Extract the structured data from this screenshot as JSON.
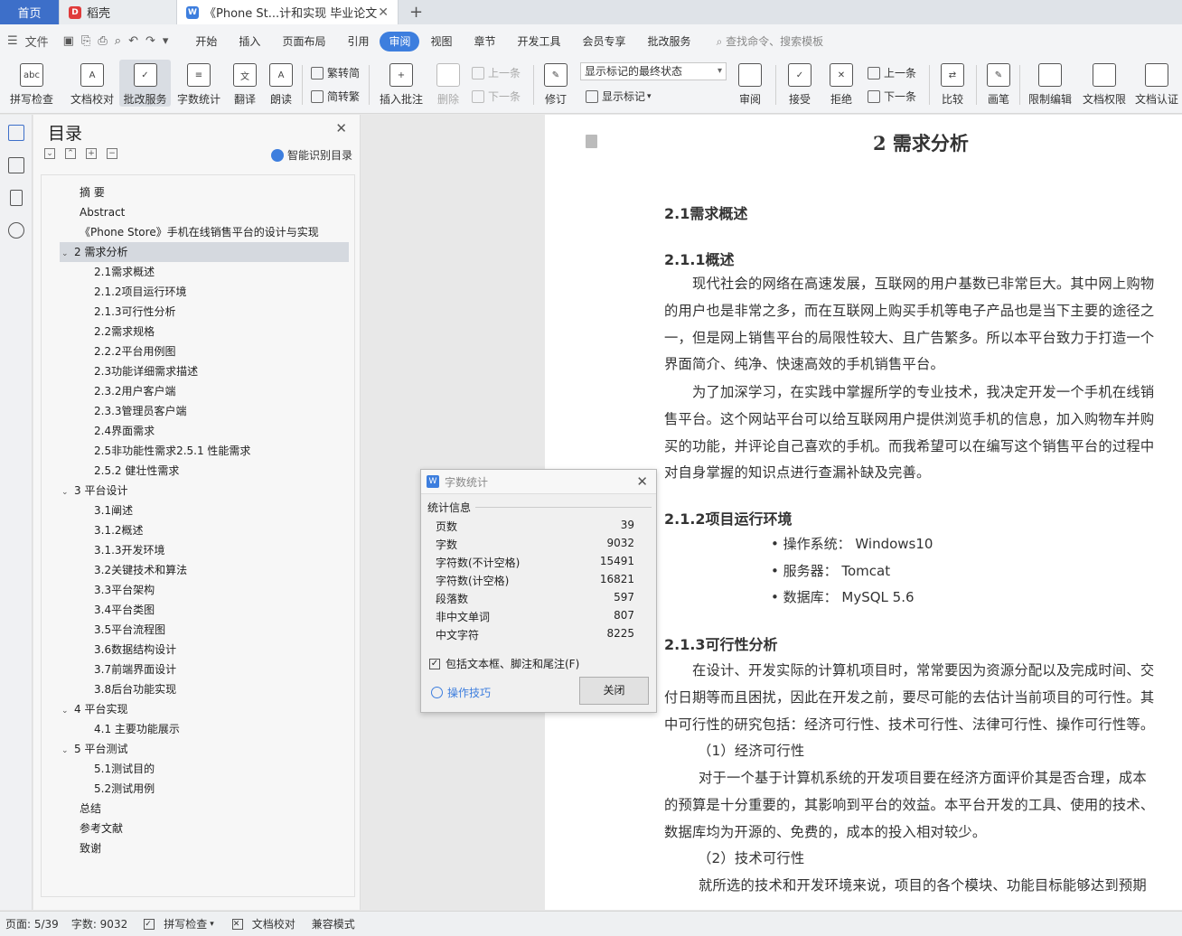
{
  "tabs": {
    "home": "首页",
    "daoke": "稻壳",
    "doc": "《Phone St...计和实现 毕业论文"
  },
  "menu": {
    "file": "文件",
    "items": [
      "开始",
      "插入",
      "页面布局",
      "引用",
      "审阅",
      "视图",
      "章节",
      "开发工具",
      "会员专享",
      "批改服务"
    ],
    "active": "审阅",
    "search": "查找命令、搜索模板"
  },
  "ribbon": {
    "spell": "拼写检查",
    "proof": "文档校对",
    "correct": "批改服务",
    "wordcount": "字数统计",
    "translate": "翻译",
    "read": "朗读",
    "trad": "繁转简",
    "simp": "简转繁",
    "insert_comment": "插入批注",
    "delete": "删除",
    "prev_comment": "上一条",
    "next_comment": "下一条",
    "revise": "修订",
    "markup_state": "显示标记的最终状态",
    "show_markup": "显示标记",
    "review": "审阅",
    "accept": "接受",
    "reject": "拒绝",
    "prev": "上一条",
    "next": "下一条",
    "compare": "比较",
    "pen": "画笔",
    "restrict": "限制编辑",
    "permission": "文档权限",
    "certify": "文档认证"
  },
  "toc": {
    "title": "目录",
    "smart": "智能识别目录",
    "items": [
      {
        "t": "摘 要",
        "l": 1
      },
      {
        "t": "Abstract",
        "l": 1
      },
      {
        "t": "《Phone Store》手机在线销售平台的设计与实现",
        "l": 1
      },
      {
        "t": "2 需求分析",
        "l": 0,
        "sel": true
      },
      {
        "t": "2.1需求概述",
        "l": 2
      },
      {
        "t": "2.1.2项目运行环境",
        "l": 2
      },
      {
        "t": "2.1.3可行性分析",
        "l": 2
      },
      {
        "t": "2.2需求规格",
        "l": 2
      },
      {
        "t": "2.2.2平台用例图",
        "l": 2
      },
      {
        "t": "2.3功能详细需求描述",
        "l": 2
      },
      {
        "t": "2.3.2用户客户端",
        "l": 2
      },
      {
        "t": "2.3.3管理员客户端",
        "l": 2
      },
      {
        "t": "2.4界面需求",
        "l": 2
      },
      {
        "t": "2.5非功能性需求2.5.1 性能需求",
        "l": 2
      },
      {
        "t": "2.5.2 健壮性需求",
        "l": 2
      },
      {
        "t": "3 平台设计",
        "l": 0
      },
      {
        "t": "3.1阐述",
        "l": 2
      },
      {
        "t": "3.1.2概述",
        "l": 2
      },
      {
        "t": "3.1.3开发环境",
        "l": 2
      },
      {
        "t": "3.2关键技术和算法",
        "l": 2
      },
      {
        "t": "3.3平台架构",
        "l": 2
      },
      {
        "t": "3.4平台类图",
        "l": 2
      },
      {
        "t": "3.5平台流程图",
        "l": 2
      },
      {
        "t": "3.6数据结构设计",
        "l": 2
      },
      {
        "t": "3.7前端界面设计",
        "l": 2
      },
      {
        "t": "3.8后台功能实现",
        "l": 2
      },
      {
        "t": "4 平台实现",
        "l": 0
      },
      {
        "t": "4.1 主要功能展示",
        "l": 2
      },
      {
        "t": "5 平台测试",
        "l": 0
      },
      {
        "t": "5.1测试目的",
        "l": 2
      },
      {
        "t": "5.2测试用例",
        "l": 2
      },
      {
        "t": "总结",
        "l": 1
      },
      {
        "t": "参考文献",
        "l": 1
      },
      {
        "t": "致谢",
        "l": 1
      }
    ]
  },
  "page": {
    "h1": "2  需求分析",
    "s21": "2.1需求概述",
    "s211": "2.1.1概述",
    "p1": [
      "现代社会的网络在高速发展，互联网的用户基数已非常巨大。其中网上购物",
      "的用户也是非常之多，而在互联网上购买手机等电子产品也是当下主要的途径之",
      "一，但是网上销售平台的局限性较大、且广告繁多。所以本平台致力于打造一个",
      "界面简介、纯净、快速高效的手机销售平台。"
    ],
    "p2": [
      "为了加深学习，在实践中掌握所学的专业技术，我决定开发一个手机在线销",
      "售平台。这个网站平台可以给互联网用户提供浏览手机的信息，加入购物车并购",
      "买的功能，并评论自己喜欢的手机。而我希望可以在编写这个销售平台的过程中",
      "对自身掌握的知识点进行查漏补缺及完善。"
    ],
    "s212": "2.1.2项目运行环境",
    "bullets": [
      "操作系统：  Windows10",
      "服务器：  Tomcat",
      "数据库：   MySQL 5.6"
    ],
    "s213": "2.1.3可行性分析",
    "p3": [
      "在设计、开发实际的计算机项目时，常常要因为资源分配以及完成时间、交",
      "付日期等而且困扰，因此在开发之前，要尽可能的去估计当前项目的可行性。其",
      "中可行性的研究包括：经济可行性、技术可行性、法律可行性、操作可行性等。"
    ],
    "e1": "（1）经济可行性",
    "p4": [
      "对于一个基于计算机系统的开发项目要在经济方面评价其是否合理，成本",
      "的预算是十分重要的，其影响到平台的效益。本平台开发的工具、使用的技术、",
      "数据库均为开源的、免费的，成本的投入相对较少。"
    ],
    "e2": "（2）技术可行性",
    "p5": "就所选的技术和开发环境来说，项目的各个模块、功能目标能够达到预期"
  },
  "dialog": {
    "title": "字数统计",
    "section": "统计信息",
    "rows": [
      {
        "k": "页数",
        "v": "39"
      },
      {
        "k": "字数",
        "v": "9032"
      },
      {
        "k": "字符数(不计空格)",
        "v": "15491"
      },
      {
        "k": "字符数(计空格)",
        "v": "16821"
      },
      {
        "k": "段落数",
        "v": "597"
      },
      {
        "k": "非中文单词",
        "v": "807"
      },
      {
        "k": "中文字符",
        "v": "8225"
      }
    ],
    "include": "包括文本框、脚注和尾注(F)",
    "tips": "操作技巧",
    "close": "关闭"
  },
  "status": {
    "page": "页面: 5/39",
    "words": "字数: 9032",
    "spell": "拼写检查",
    "proof": "文档校对",
    "compat": "兼容模式"
  }
}
